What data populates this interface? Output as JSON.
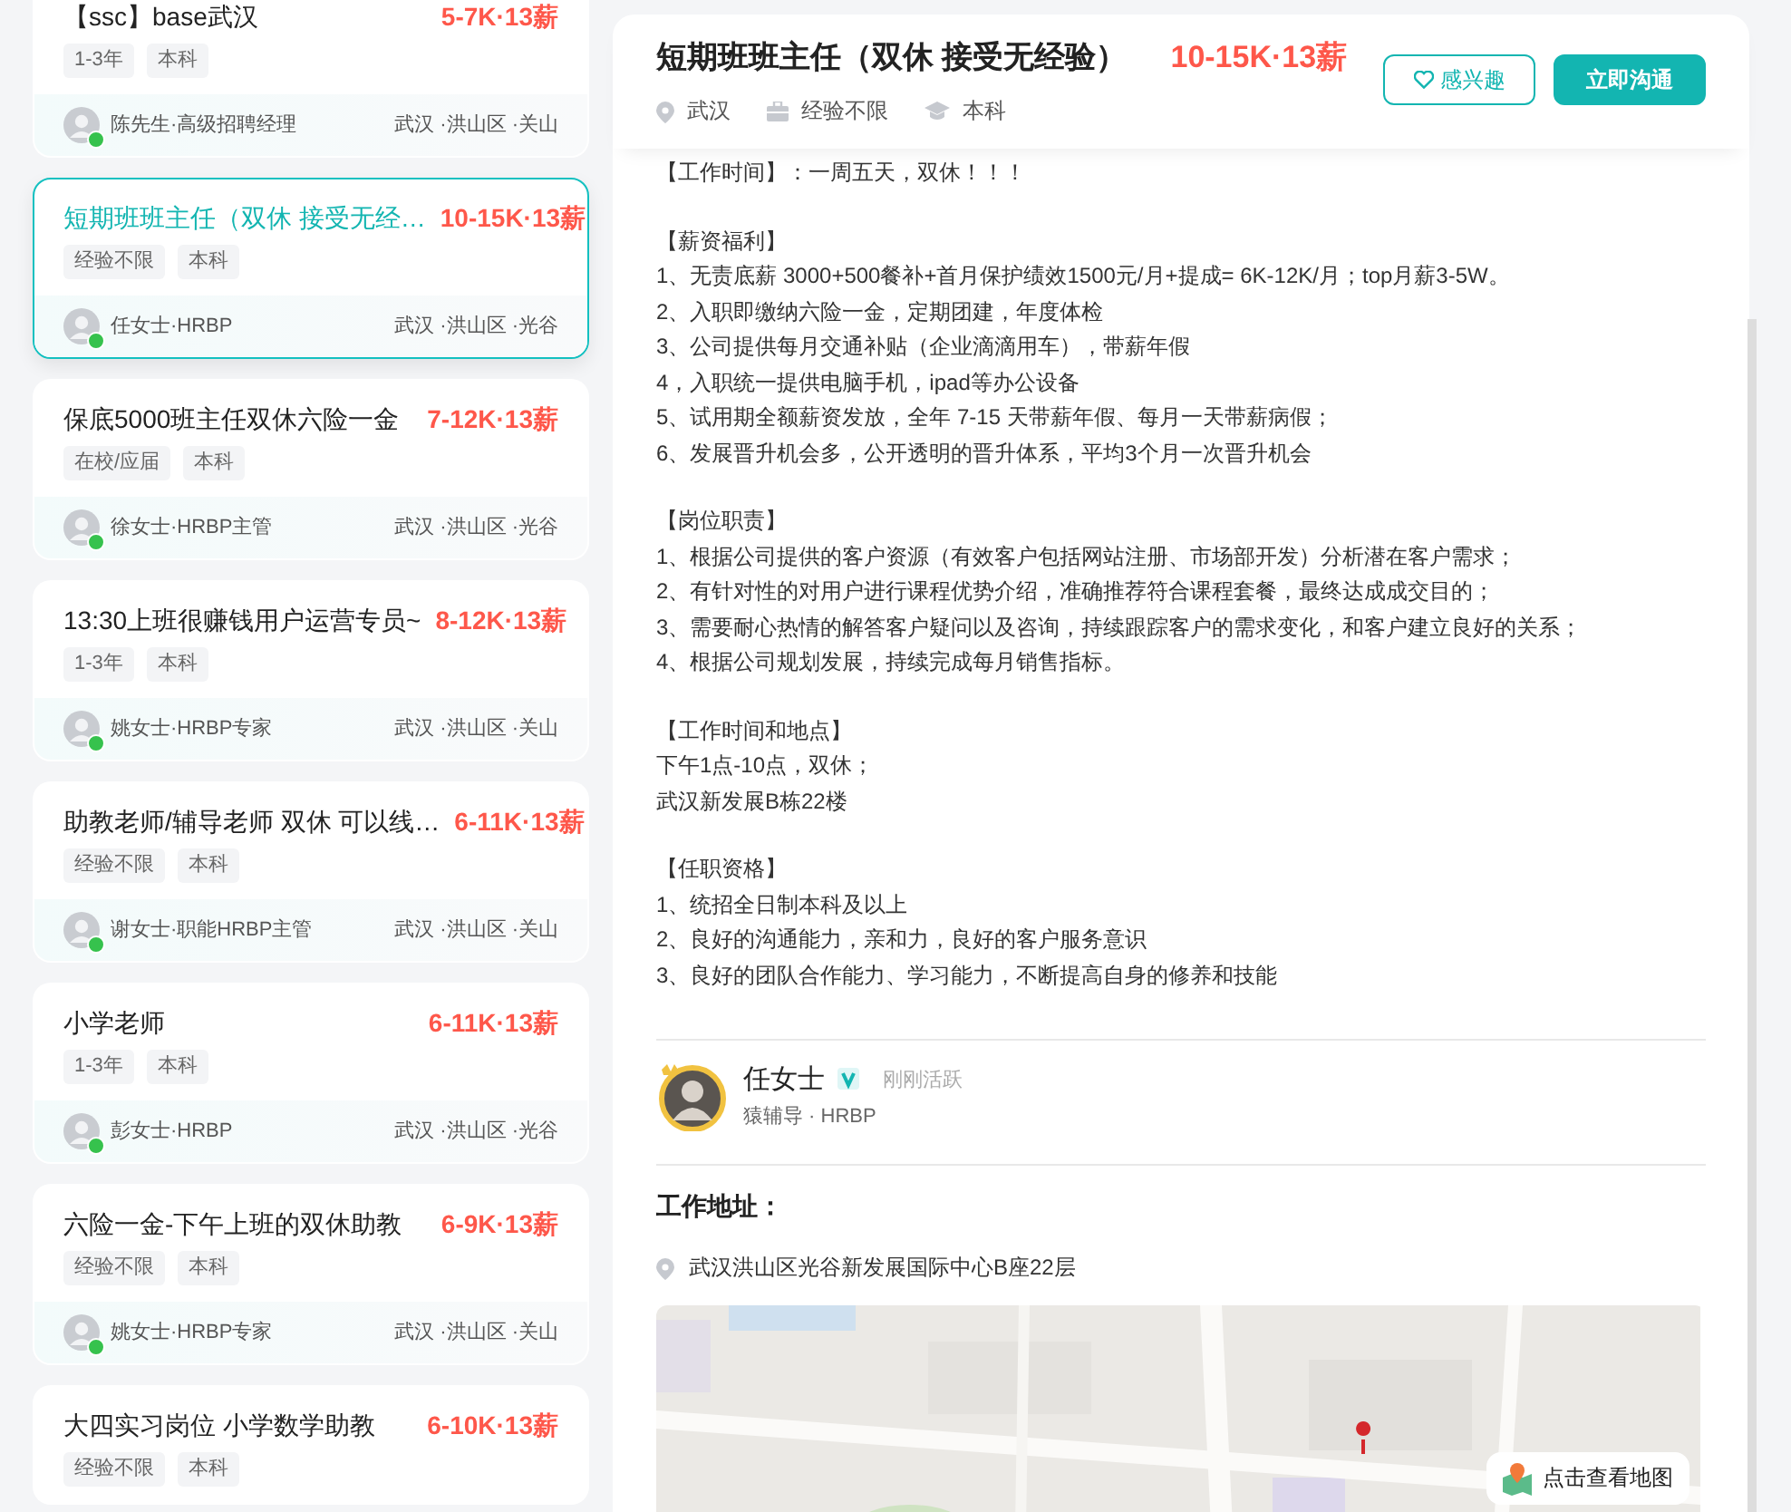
{
  "jobs": [
    {
      "title": "【ssc】base武汉",
      "salary": "5-7K·13薪",
      "tags": [
        "1-3年",
        "本科"
      ],
      "recruiter": "陈先生·高级招聘经理",
      "online": true,
      "location": "武汉 ·洪山区 ·关山",
      "selected": false
    },
    {
      "title": "短期班班主任（双休 接受无经…",
      "salary": "10-15K·13薪",
      "tags": [
        "经验不限",
        "本科"
      ],
      "recruiter": "任女士·HRBP",
      "online": true,
      "location": "武汉 ·洪山区 ·光谷",
      "selected": true
    },
    {
      "title": "保底5000班主任双休六险一金",
      "salary": "7-12K·13薪",
      "tags": [
        "在校/应届",
        "本科"
      ],
      "recruiter": "徐女士·HRBP主管",
      "online": true,
      "location": "武汉 ·洪山区 ·光谷",
      "selected": false
    },
    {
      "title": "13:30上班很赚钱用户运营专员~",
      "salary": "8-12K·13薪",
      "tags": [
        "1-3年",
        "本科"
      ],
      "recruiter": "姚女士·HRBP专家",
      "online": true,
      "location": "武汉 ·洪山区 ·关山",
      "selected": false
    },
    {
      "title": "助教老师/辅导老师 双休 可以线…",
      "salary": "6-11K·13薪",
      "tags": [
        "经验不限",
        "本科"
      ],
      "recruiter": "谢女士·职能HRBP主管",
      "online": true,
      "location": "武汉 ·洪山区 ·关山",
      "selected": false
    },
    {
      "title": "小学老师",
      "salary": "6-11K·13薪",
      "tags": [
        "1-3年",
        "本科"
      ],
      "recruiter": "彭女士·HRBP",
      "online": true,
      "location": "武汉 ·洪山区 ·光谷",
      "selected": false
    },
    {
      "title": "六险一金-下午上班的双休助教",
      "salary": "6-9K·13薪",
      "tags": [
        "经验不限",
        "本科"
      ],
      "recruiter": "姚女士·HRBP专家",
      "online": true,
      "location": "武汉 ·洪山区 ·关山",
      "selected": false
    },
    {
      "title": "大四实习岗位 小学数学助教",
      "salary": "6-10K·13薪",
      "tags": [
        "经验不限",
        "本科"
      ],
      "selected": false
    }
  ],
  "detail": {
    "title": "短期班班主任（双休 接受无经验）",
    "salary": "10-15K·13薪",
    "meta": [
      {
        "kind": "location",
        "text": "武汉"
      },
      {
        "kind": "experience",
        "text": "经验不限"
      },
      {
        "kind": "degree",
        "text": "本科"
      }
    ],
    "buttons": {
      "interest": "感兴趣",
      "chat": "立即沟通"
    },
    "description": [
      [
        "【工作时间】：一周五天，双休！！！"
      ],
      [
        "【薪资福利】",
        "1、无责底薪 3000+500餐补+首月保护绩效1500元/月+提成= 6K-12K/月；top月薪3-5W。",
        "2、入职即缴纳六险一金，定期团建，年度体检",
        "3、公司提供每月交通补贴（企业滴滴用车），带薪年假",
        "4，入职统一提供电脑手机，ipad等办公设备",
        "5、试用期全额薪资发放，全年 7-15 天带薪年假、每月一天带薪病假；",
        "6、发展晋升机会多，公开透明的晋升体系，平均3个月一次晋升机会"
      ],
      [
        "【岗位职责】",
        "1、根据公司提供的客户资源（有效客户包括网站注册、市场部开发）分析潜在客户需求；",
        "2、有针对性的对用户进行课程优势介绍，准确推荐符合课程套餐，最终达成成交目的；",
        "3、需要耐心热情的解答客户疑问以及咨询，持续跟踪客户的需求变化，和客户建立良好的关系；",
        "4、根据公司规划发展，持续完成每月销售指标。"
      ],
      [
        "【工作时间和地点】",
        "下午1点-10点，双休；",
        "武汉新发展B栋22楼"
      ],
      [
        "【任职资格】",
        "1、统招全日制本科及以上",
        "2、良好的沟通能力，亲和力，良好的客户服务意识",
        "3、良好的团队合作能力、学习能力，不断提高自身的修养和技能"
      ]
    ],
    "recruiter": {
      "name": "任女士",
      "verified": true,
      "status": "刚刚活跃",
      "title": "猿辅导 · HRBP"
    },
    "address_heading": "工作地址：",
    "address": "武汉洪山区光谷新发展国际中心B座22层",
    "map": {
      "kind": "picture",
      "button": "点击查看地图"
    }
  }
}
